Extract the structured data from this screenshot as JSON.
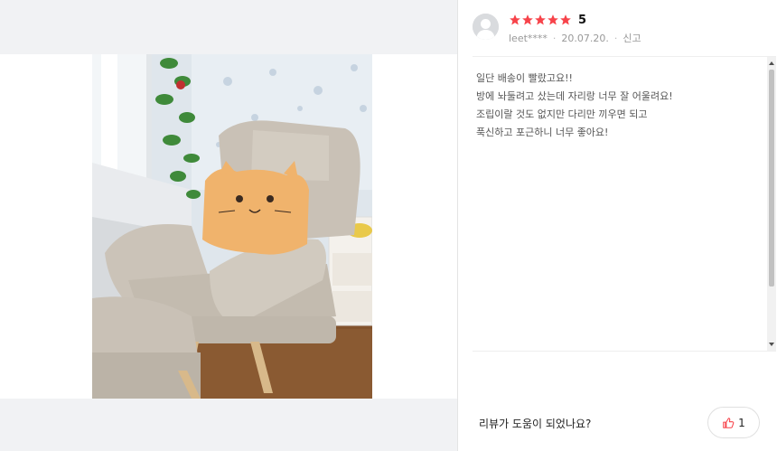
{
  "review": {
    "rating": 5,
    "rating_label": "5",
    "username": "leet****",
    "date": "20.07.20.",
    "report_label": "신고",
    "body_lines": [
      "일단 배송이 빨랐고요!!",
      "방에 놔둘려고 샀는데 자리랑 너무 잘 어울려요!",
      "조립이랄 것도 없지만 다리만 끼우면 되고",
      "푹신하고 포근하니 너무 좋아요!"
    ]
  },
  "footer": {
    "helpful_question": "리뷰가 도움이 되었나요?",
    "like_count": "1"
  },
  "colors": {
    "star": "#f7434a",
    "like_icon": "#f7434a"
  },
  "icons": {
    "avatar": "default-user-avatar",
    "like": "thumbs-up-icon"
  }
}
